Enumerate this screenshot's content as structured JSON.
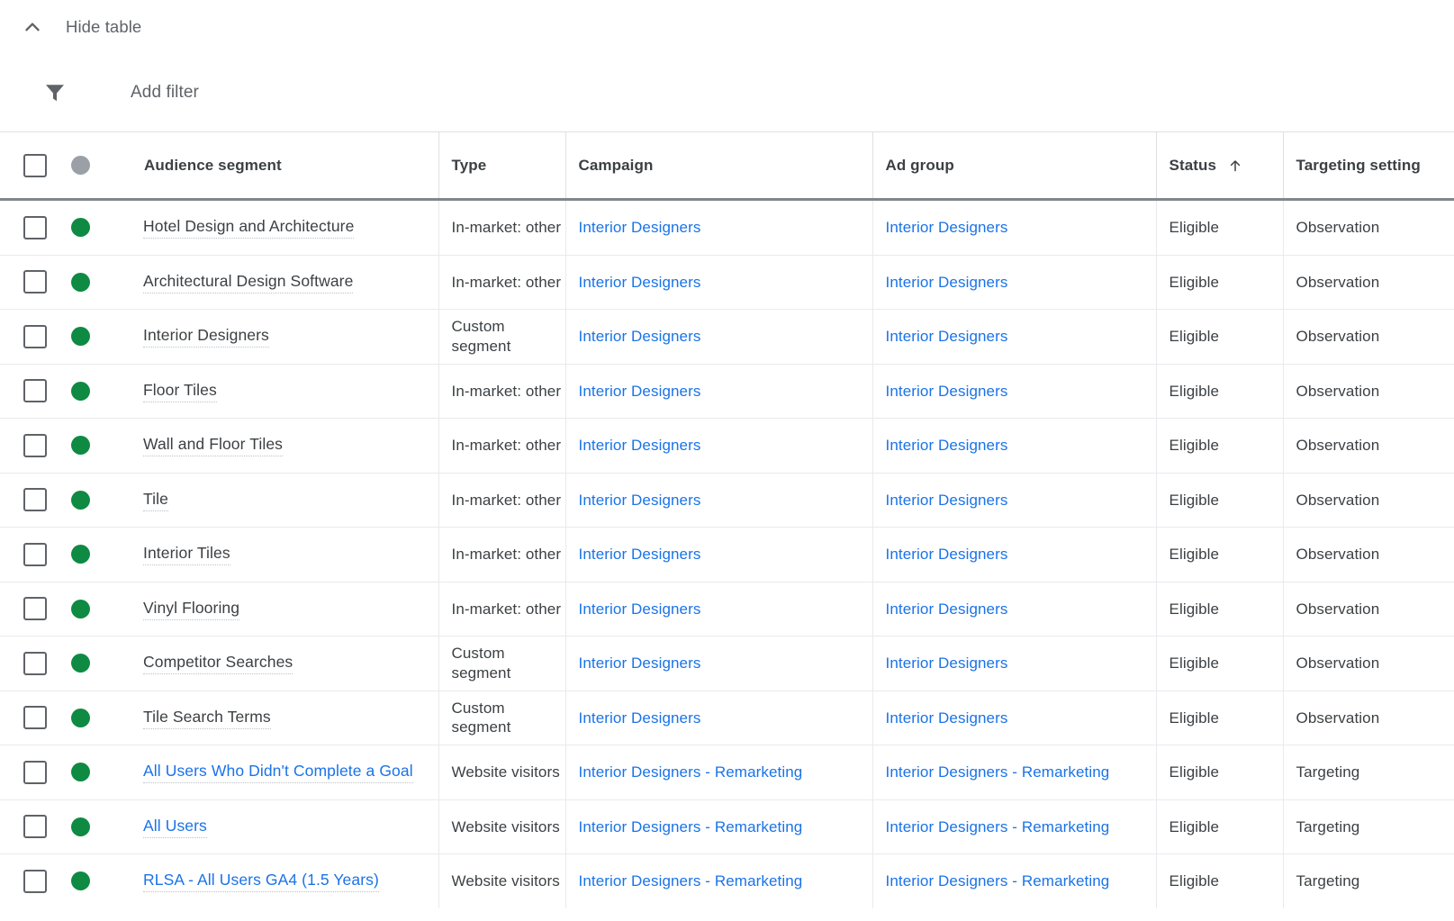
{
  "toolbar": {
    "hide_table_label": "Hide table",
    "chevron_icon": "chevron-up-icon",
    "add_filter_label": "Add filter",
    "filter_icon": "filter-icon"
  },
  "colors": {
    "link_blue": "#1a73e8",
    "status_green": "#0e8a43",
    "status_grey": "#9aa0a6",
    "text_primary": "#3c4043",
    "text_secondary": "#5f6368"
  },
  "table": {
    "sort": {
      "column": "Status",
      "direction": "ascending",
      "arrow_icon": "arrow-up-icon"
    },
    "columns": [
      {
        "key": "checkbox",
        "label": ""
      },
      {
        "key": "dot",
        "label": ""
      },
      {
        "key": "segment",
        "label": "Audience segment"
      },
      {
        "key": "type",
        "label": "Type"
      },
      {
        "key": "campaign",
        "label": "Campaign"
      },
      {
        "key": "adgroup",
        "label": "Ad group"
      },
      {
        "key": "status",
        "label": "Status"
      },
      {
        "key": "targeting",
        "label": "Targeting setting"
      }
    ],
    "rows": [
      {
        "dot": "green",
        "segment": "Hotel Design and Architecture",
        "segment_style": "plain",
        "type": "In-market: other",
        "campaign": "Interior Designers",
        "adgroup": "Interior Designers",
        "status": "Eligible",
        "targeting": "Observation"
      },
      {
        "dot": "green",
        "segment": "Architectural Design Software",
        "segment_style": "plain",
        "type": "In-market: other",
        "campaign": "Interior Designers",
        "adgroup": "Interior Designers",
        "status": "Eligible",
        "targeting": "Observation"
      },
      {
        "dot": "green",
        "segment": "Interior Designers",
        "segment_style": "plain",
        "type": "Custom segment",
        "campaign": "Interior Designers",
        "adgroup": "Interior Designers",
        "status": "Eligible",
        "targeting": "Observation"
      },
      {
        "dot": "green",
        "segment": "Floor Tiles",
        "segment_style": "plain",
        "type": "In-market: other",
        "campaign": "Interior Designers",
        "adgroup": "Interior Designers",
        "status": "Eligible",
        "targeting": "Observation"
      },
      {
        "dot": "green",
        "segment": "Wall and Floor Tiles",
        "segment_style": "plain",
        "type": "In-market: other",
        "campaign": "Interior Designers",
        "adgroup": "Interior Designers",
        "status": "Eligible",
        "targeting": "Observation"
      },
      {
        "dot": "green",
        "segment": "Tile",
        "segment_style": "plain",
        "type": "In-market: other",
        "campaign": "Interior Designers",
        "adgroup": "Interior Designers",
        "status": "Eligible",
        "targeting": "Observation"
      },
      {
        "dot": "green",
        "segment": "Interior Tiles",
        "segment_style": "plain",
        "type": "In-market: other",
        "campaign": "Interior Designers",
        "adgroup": "Interior Designers",
        "status": "Eligible",
        "targeting": "Observation"
      },
      {
        "dot": "green",
        "segment": "Vinyl Flooring",
        "segment_style": "plain",
        "type": "In-market: other",
        "campaign": "Interior Designers",
        "adgroup": "Interior Designers",
        "status": "Eligible",
        "targeting": "Observation"
      },
      {
        "dot": "green",
        "segment": "Competitor Searches",
        "segment_style": "plain",
        "type": "Custom segment",
        "campaign": "Interior Designers",
        "adgroup": "Interior Designers",
        "status": "Eligible",
        "targeting": "Observation"
      },
      {
        "dot": "green",
        "segment": "Tile Search Terms",
        "segment_style": "plain",
        "type": "Custom segment",
        "campaign": "Interior Designers",
        "adgroup": "Interior Designers",
        "status": "Eligible",
        "targeting": "Observation"
      },
      {
        "dot": "green",
        "segment": "All Users Who Didn't Complete a Goal",
        "segment_style": "link",
        "type": "Website visitors",
        "campaign": "Interior Designers - Remarketing",
        "adgroup": "Interior Designers - Remarketing",
        "status": "Eligible",
        "targeting": "Targeting"
      },
      {
        "dot": "green",
        "segment": "All Users",
        "segment_style": "link",
        "type": "Website visitors",
        "campaign": "Interior Designers - Remarketing",
        "adgroup": "Interior Designers - Remarketing",
        "status": "Eligible",
        "targeting": "Targeting"
      },
      {
        "dot": "green",
        "segment": "RLSA - All Users GA4 (1.5 Years)",
        "segment_style": "link",
        "type": "Website visitors",
        "campaign": "Interior Designers - Remarketing",
        "adgroup": "Interior Designers - Remarketing",
        "status": "Eligible",
        "targeting": "Targeting"
      }
    ]
  }
}
